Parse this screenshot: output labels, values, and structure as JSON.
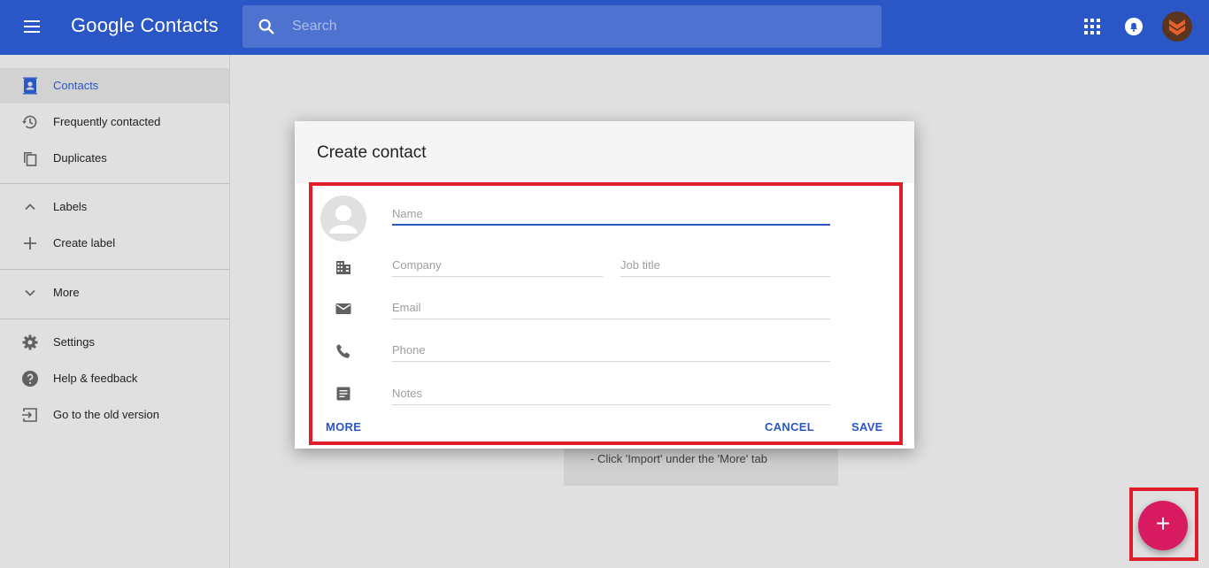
{
  "header": {
    "app_title": "Google Contacts",
    "search_placeholder": "Search",
    "icons": [
      "menu-icon",
      "search-icon",
      "apps-icon",
      "notifications-icon",
      "account-avatar"
    ]
  },
  "sidebar": {
    "items": [
      {
        "label": "Contacts",
        "icon": "contacts-icon",
        "active": true
      },
      {
        "label": "Frequently contacted",
        "icon": "history-icon"
      },
      {
        "label": "Duplicates",
        "icon": "duplicates-icon"
      },
      {
        "label": "Labels",
        "icon": "chevron-up-icon"
      },
      {
        "label": "Create label",
        "icon": "plus-icon"
      },
      {
        "label": "More",
        "icon": "chevron-down-icon"
      },
      {
        "label": "Settings",
        "icon": "gear-icon"
      },
      {
        "label": "Help & feedback",
        "icon": "help-icon"
      },
      {
        "label": "Go to the old version",
        "icon": "exit-icon"
      }
    ]
  },
  "background": {
    "hint_text": "- Click 'Import' under the 'More' tab"
  },
  "dialog": {
    "title": "Create contact",
    "fields": {
      "name": {
        "placeholder": "Name",
        "value": ""
      },
      "company": {
        "placeholder": "Company",
        "value": ""
      },
      "job_title": {
        "placeholder": "Job title",
        "value": ""
      },
      "email": {
        "placeholder": "Email",
        "value": ""
      },
      "phone": {
        "placeholder": "Phone",
        "value": ""
      },
      "notes": {
        "placeholder": "Notes",
        "value": ""
      }
    },
    "buttons": {
      "more": "MORE",
      "cancel": "CANCEL",
      "save": "SAVE"
    }
  },
  "fab": {
    "label": "+"
  },
  "colors": {
    "brand": "#2a56c6",
    "fab": "#d81b60",
    "highlight": "#e01e2a",
    "background": "#e0e0e0"
  }
}
